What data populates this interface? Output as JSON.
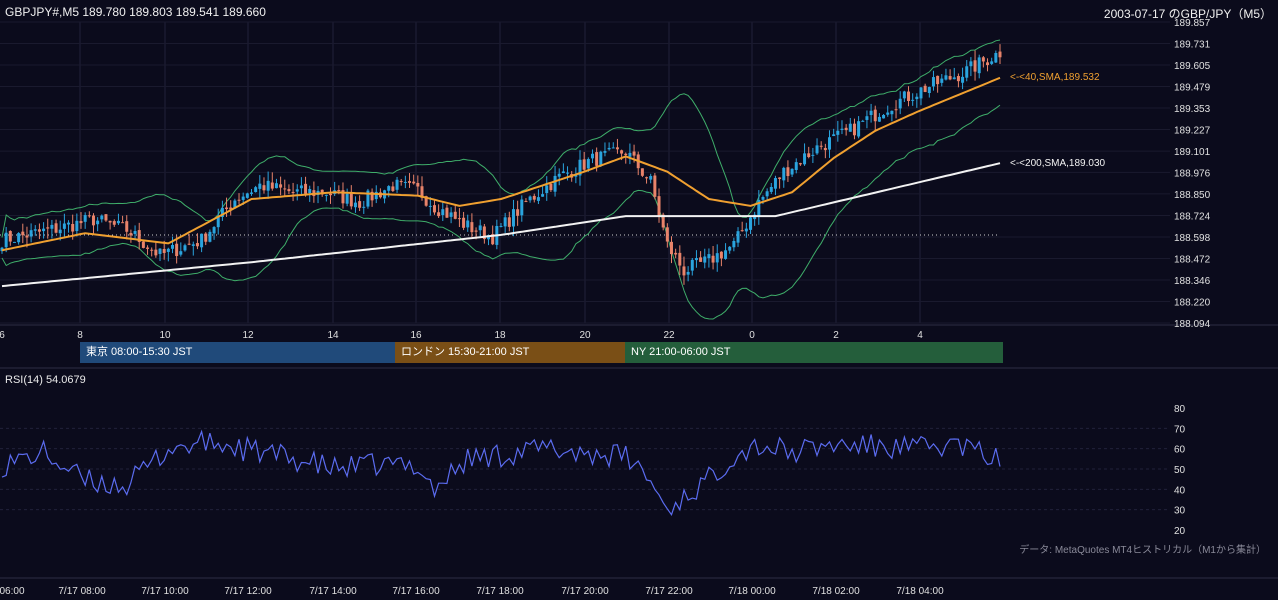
{
  "header": {
    "left_text": "GBPJPY#,M5 189.780 189.803 189.541 189.660",
    "right_text": "2003-07-17 のGBP/JPY（M5）"
  },
  "rsi_panel": {
    "title": "RSI(14) 54.0679",
    "levels": [
      "80",
      "70",
      "60",
      "50",
      "40",
      "30",
      "20"
    ]
  },
  "data_note": "データ: MetaQuotes MT4ヒストリカル（M1から集計）",
  "sessions": [
    {
      "label": "東京 08:00-15:30 JST",
      "color": "#204a7a"
    },
    {
      "label": "ロンドン 15:30-21:00 JST",
      "color": "#7a4f16"
    },
    {
      "label": "NY 21:00-06:00 JST",
      "color": "#245e3b"
    }
  ],
  "ma_labels": {
    "sma40": "<-<40,SMA,189.532",
    "sma200": "<-<200,SMA,189.030"
  },
  "colors": {
    "bull": "#2aa4de",
    "bear": "#e8836a",
    "sma40": "#f0a030",
    "sma200": "#f2f2f2",
    "bollinger": "#3fae6a",
    "rsi": "#5b6cf0",
    "background": "#0b0b1c",
    "grid": "#22223a"
  },
  "chart_data": [
    {
      "type": "candlestick",
      "title": "",
      "price_axis_ticks": [
        "189.857",
        "189.731",
        "189.605",
        "189.479",
        "189.353",
        "189.227",
        "189.101",
        "188.976",
        "188.850",
        "188.724",
        "188.598",
        "188.472",
        "188.346",
        "188.220",
        "188.094"
      ],
      "ylim": [
        188.094,
        189.857
      ],
      "time_axis_ticks": [
        "6",
        "8",
        "10",
        "12",
        "14",
        "16",
        "18",
        "20",
        "22",
        "0",
        "2",
        "4"
      ],
      "series": [
        {
          "name": "SMA 40",
          "last_value": 189.532
        },
        {
          "name": "SMA 200",
          "last_value": 189.03
        }
      ],
      "approx_path": {
        "close_anchors": [
          [
            0,
            188.58
          ],
          [
            12,
            188.64
          ],
          [
            22,
            188.7
          ],
          [
            30,
            188.64
          ],
          [
            38,
            188.49
          ],
          [
            48,
            188.58
          ],
          [
            56,
            188.82
          ],
          [
            62,
            188.9
          ],
          [
            70,
            188.86
          ],
          [
            78,
            188.86
          ],
          [
            86,
            188.8
          ],
          [
            94,
            188.9
          ],
          [
            100,
            188.87
          ],
          [
            104,
            188.78
          ],
          [
            112,
            188.66
          ],
          [
            118,
            188.6
          ],
          [
            126,
            188.8
          ],
          [
            134,
            188.95
          ],
          [
            142,
            189.05
          ],
          [
            150,
            189.1
          ],
          [
            156,
            188.92
          ],
          [
            160,
            188.55
          ],
          [
            164,
            188.4
          ],
          [
            170,
            188.46
          ],
          [
            176,
            188.55
          ],
          [
            182,
            188.8
          ],
          [
            188,
            188.98
          ],
          [
            196,
            189.12
          ],
          [
            204,
            189.22
          ],
          [
            212,
            189.35
          ],
          [
            222,
            189.47
          ],
          [
            232,
            189.57
          ],
          [
            240,
            189.68
          ]
        ],
        "sma40_anchors": [
          [
            0,
            188.52
          ],
          [
            20,
            188.62
          ],
          [
            40,
            188.56
          ],
          [
            60,
            188.82
          ],
          [
            80,
            188.86
          ],
          [
            100,
            188.84
          ],
          [
            110,
            188.78
          ],
          [
            120,
            188.82
          ],
          [
            140,
            188.98
          ],
          [
            150,
            189.07
          ],
          [
            160,
            188.98
          ],
          [
            170,
            188.82
          ],
          [
            180,
            188.78
          ],
          [
            190,
            188.86
          ],
          [
            200,
            189.06
          ],
          [
            210,
            189.22
          ],
          [
            220,
            189.33
          ],
          [
            232,
            189.45
          ],
          [
            240,
            189.53
          ]
        ],
        "sma200_anchors": [
          [
            0,
            188.31
          ],
          [
            60,
            188.45
          ],
          [
            120,
            188.61
          ],
          [
            150,
            188.72
          ],
          [
            186,
            188.72
          ],
          [
            240,
            189.03
          ]
        ]
      }
    },
    {
      "type": "line",
      "title": "RSI(14) 54.0679",
      "ylim": [
        20,
        80
      ],
      "time_axis_ticks": [
        "06:00",
        "7/17 08:00",
        "7/17 10:00",
        "7/17 12:00",
        "7/17 14:00",
        "7/17 16:00",
        "7/17 18:00",
        "7/17 20:00",
        "7/17 22:00",
        "7/18 00:00",
        "7/18 02:00",
        "7/18 04:00"
      ],
      "last_value": 54.0679,
      "approx_path": {
        "anchors": [
          [
            0,
            52
          ],
          [
            10,
            58
          ],
          [
            20,
            44
          ],
          [
            30,
            42
          ],
          [
            40,
            60
          ],
          [
            50,
            63
          ],
          [
            60,
            59
          ],
          [
            70,
            55
          ],
          [
            80,
            50
          ],
          [
            90,
            52
          ],
          [
            100,
            52
          ],
          [
            104,
            40
          ],
          [
            112,
            55
          ],
          [
            120,
            57
          ],
          [
            130,
            60
          ],
          [
            140,
            58
          ],
          [
            150,
            56
          ],
          [
            155,
            47
          ],
          [
            160,
            30
          ],
          [
            164,
            36
          ],
          [
            170,
            45
          ],
          [
            176,
            57
          ],
          [
            182,
            62
          ],
          [
            190,
            58
          ],
          [
            200,
            62
          ],
          [
            210,
            61
          ],
          [
            220,
            60
          ],
          [
            230,
            62
          ],
          [
            240,
            54
          ]
        ]
      }
    }
  ]
}
